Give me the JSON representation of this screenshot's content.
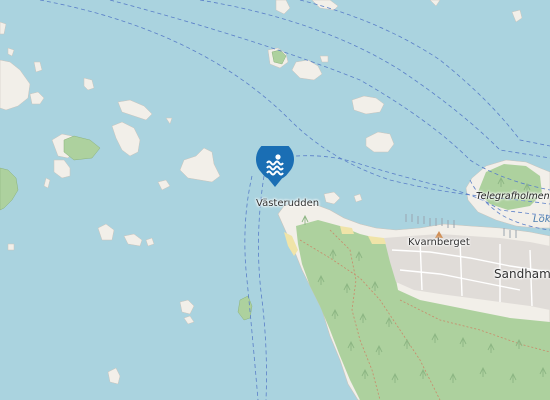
{
  "map": {
    "labels": {
      "beach": "Västerudden",
      "village_hill": "Kvarnberget",
      "town": "Sandhamn",
      "island": "Telegrafholmen",
      "water": "Lökh"
    },
    "marker": {
      "icon": "swimming-icon",
      "color": "#1a6eb4",
      "labels": "beach"
    },
    "colors": {
      "water": "#aad3df",
      "land": "#f2efe9",
      "forest": "#add19e",
      "urban": "#e0dcd8",
      "sand": "#f0e4a8",
      "route": "#5a7fc8"
    },
    "layers": {
      "forest_symbols": "tree-icon",
      "peak_symbol": "peak-triangle-icon",
      "routes": "dashed-ferry-route"
    }
  }
}
